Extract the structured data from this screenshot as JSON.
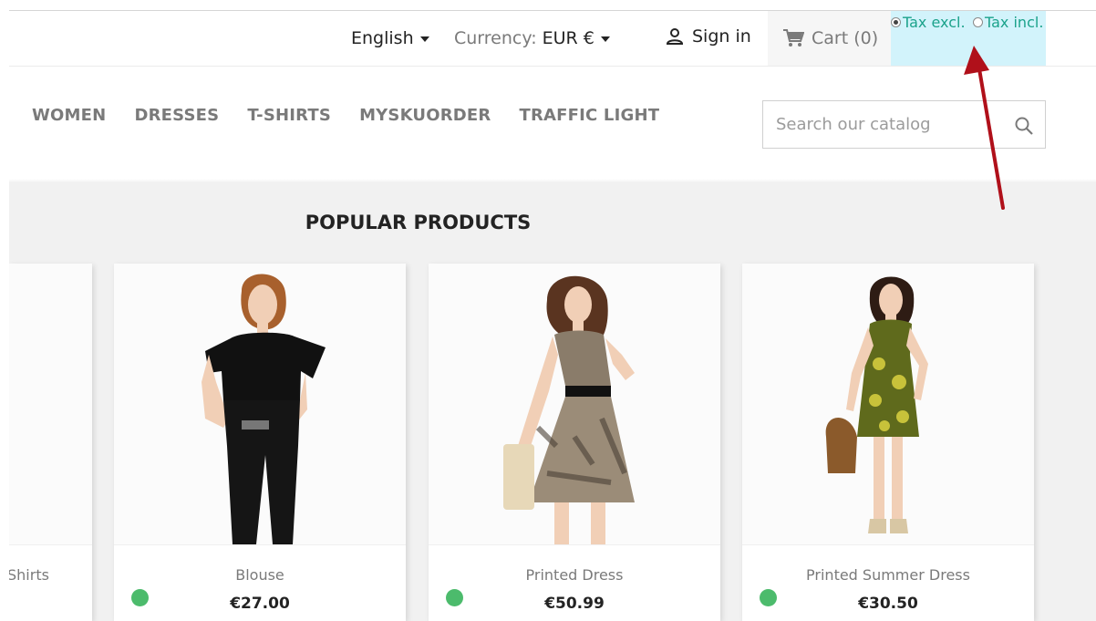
{
  "header": {
    "language": "English",
    "currency_label": "Currency:",
    "currency_value": "EUR €",
    "signin": "Sign in",
    "cart": "Cart (0)",
    "tax_excl": "Tax excl.",
    "tax_incl": "Tax incl.",
    "tax_selected": "Tax excl."
  },
  "menu": {
    "items": [
      "WOMEN",
      "DRESSES",
      "T-SHIRTS",
      "MYSKUORDER",
      "TRAFFIC LIGHT"
    ]
  },
  "search": {
    "placeholder": "Search our catalog"
  },
  "section_title": "POPULAR PRODUCTS",
  "products": [
    {
      "name": "Shirts",
      "price": ""
    },
    {
      "name": "Blouse",
      "price": "€27.00"
    },
    {
      "name": "Printed Dress",
      "price": "€50.99"
    },
    {
      "name": "Printed Summer Dress",
      "price": "€30.50"
    }
  ],
  "colors": {
    "accent_green": "#4cbb6c",
    "tax_bg": "#d2f3fb",
    "tax_text": "#1ba28b",
    "arrow": "#b0101a"
  }
}
